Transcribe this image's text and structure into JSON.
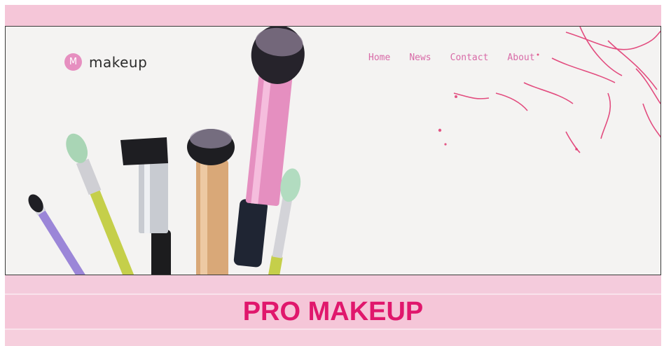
{
  "header": {
    "logo_letter": "M",
    "logo_text": "makeup"
  },
  "nav": {
    "items": [
      {
        "label": "Home"
      },
      {
        "label": "News"
      },
      {
        "label": "Contact"
      },
      {
        "label": "About"
      }
    ]
  },
  "hero": {
    "image": "makeup-brushes-photo"
  },
  "banner": {
    "headline": "PRO MAKEUP"
  },
  "colors": {
    "band": "#f5c6d8",
    "accent": "#e0176c",
    "nav_link": "#d86aa7",
    "logo_badge": "#e68fc0"
  }
}
